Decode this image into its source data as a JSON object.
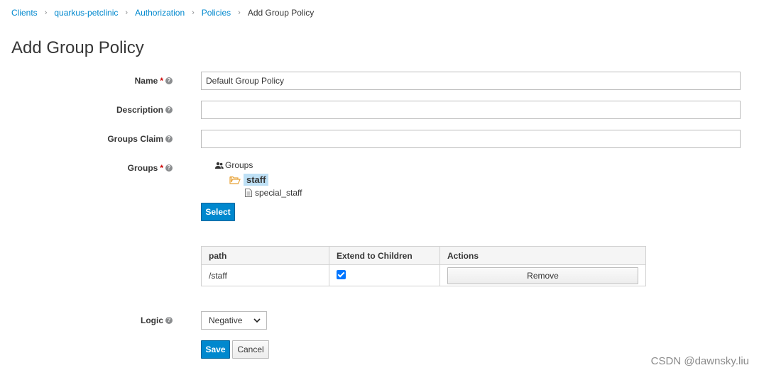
{
  "breadcrumb": {
    "items": [
      "Clients",
      "quarkus-petclinic",
      "Authorization",
      "Policies"
    ],
    "current": "Add Group Policy"
  },
  "page_title": "Add Group Policy",
  "form": {
    "name": {
      "label": "Name",
      "value": "Default Group Policy"
    },
    "description": {
      "label": "Description",
      "value": ""
    },
    "groups_claim": {
      "label": "Groups Claim",
      "value": ""
    },
    "groups": {
      "label": "Groups",
      "tree": {
        "root": "Groups",
        "selected": "staff",
        "child": "special_staff"
      },
      "select_label": "Select"
    },
    "table": {
      "columns": [
        "path",
        "Extend to Children",
        "Actions"
      ],
      "rows": [
        {
          "path": "/staff",
          "extend": true,
          "action": "Remove"
        }
      ]
    },
    "logic": {
      "label": "Logic",
      "value": "Negative"
    },
    "save_label": "Save",
    "cancel_label": "Cancel"
  },
  "watermark": "CSDN @dawnsky.liu",
  "colors": {
    "primary": "#0088ce",
    "selected_bg": "#bee0f5",
    "required": "#cc0000"
  }
}
